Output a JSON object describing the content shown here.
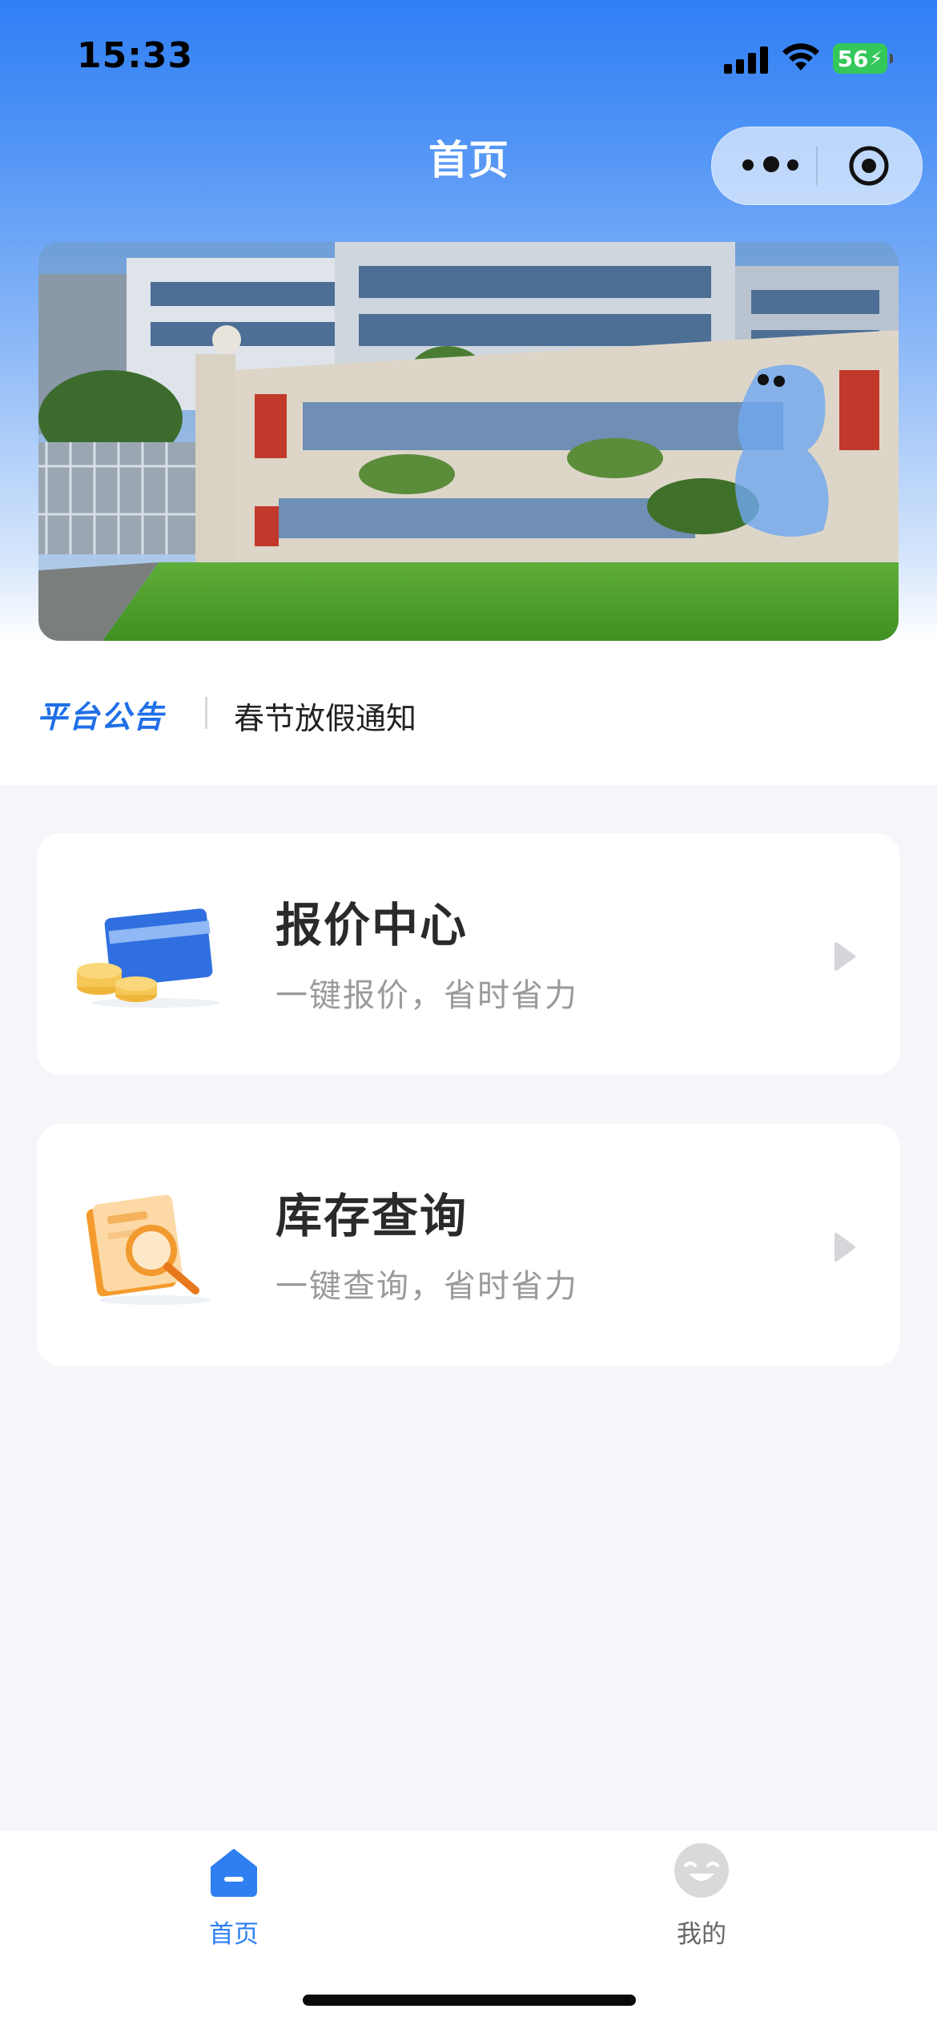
{
  "status_bar": {
    "time": "15:33",
    "battery": "56"
  },
  "nav": {
    "title": "首页"
  },
  "capsule": {
    "more_icon": "more-dots-icon",
    "close_icon": "target-circle-icon"
  },
  "banner": {
    "image": "factory-building-photo"
  },
  "notice": {
    "tag": "平台公告",
    "text": "春节放假通知"
  },
  "cards": [
    {
      "title": "报价中心",
      "subtitle": "一键报价，省时省力",
      "icon": "credit-card-coins-icon"
    },
    {
      "title": "库存查询",
      "subtitle": "一键查询，省时省力",
      "icon": "document-magnifier-icon"
    }
  ],
  "tabbar": {
    "items": [
      {
        "label": "首页",
        "icon": "home-icon",
        "active": true
      },
      {
        "label": "我的",
        "icon": "smiley-avatar-icon",
        "active": false
      }
    ]
  },
  "colors": {
    "accent": "#1f6fe8",
    "active_tab": "#2f7ff0",
    "inactive_tab": "#666666"
  }
}
